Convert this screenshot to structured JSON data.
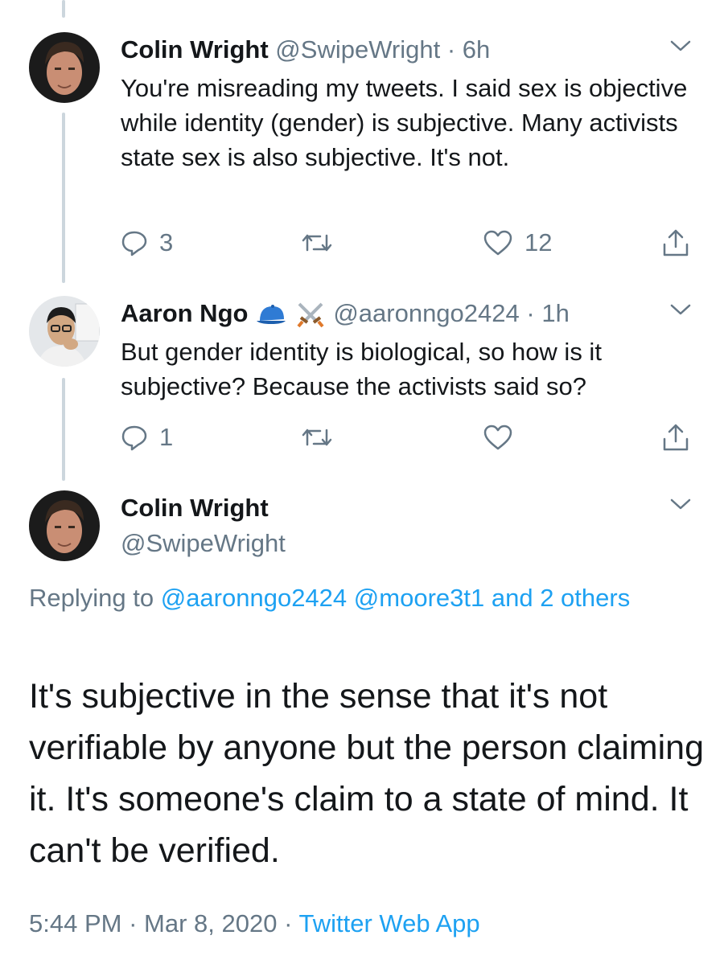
{
  "tweets": [
    {
      "name": "Colin Wright",
      "handle": "@SwipeWright",
      "separator": "·",
      "time": "6h",
      "text": "You're misreading my tweets. I said sex is objective while identity (gender) is subjective. Many activists state sex is also subjective. It's not.",
      "reply_count": "3",
      "retweet_count": "",
      "like_count": "12"
    },
    {
      "name": "Aaron Ngo",
      "badges": [
        "blue-cap-emoji",
        "crossed-swords-emoji"
      ],
      "handle": "@aaronngo2424",
      "separator": "·",
      "time": "1h",
      "text": "But gender identity is biological, so how is it subjective? Because the activists said so?",
      "reply_count": "1",
      "retweet_count": "",
      "like_count": ""
    }
  ],
  "main_tweet": {
    "name": "Colin Wright",
    "handle": "@SwipeWright",
    "replying_prefix": "Replying to",
    "replying_user1": "@aaronngo2424",
    "replying_user2": "@moore3t1",
    "replying_others": "and 2 others",
    "text": "It's subjective in the sense that it's not verifiable by anyone but the person claiming it. It's someone's claim to a state of mind. It can't be verified.",
    "time": "5:44 PM",
    "separator1": "·",
    "date": "Mar 8, 2020",
    "separator2": "·",
    "source": "Twitter Web App"
  },
  "icons": {
    "reply": "reply-icon",
    "retweet": "retweet-icon",
    "like": "heart-icon",
    "share": "share-icon",
    "more": "chevron-down-icon"
  },
  "colors": {
    "text": "#14171a",
    "secondary": "#657786",
    "link": "#1da1f2",
    "thread_line": "#ccd6dd"
  }
}
